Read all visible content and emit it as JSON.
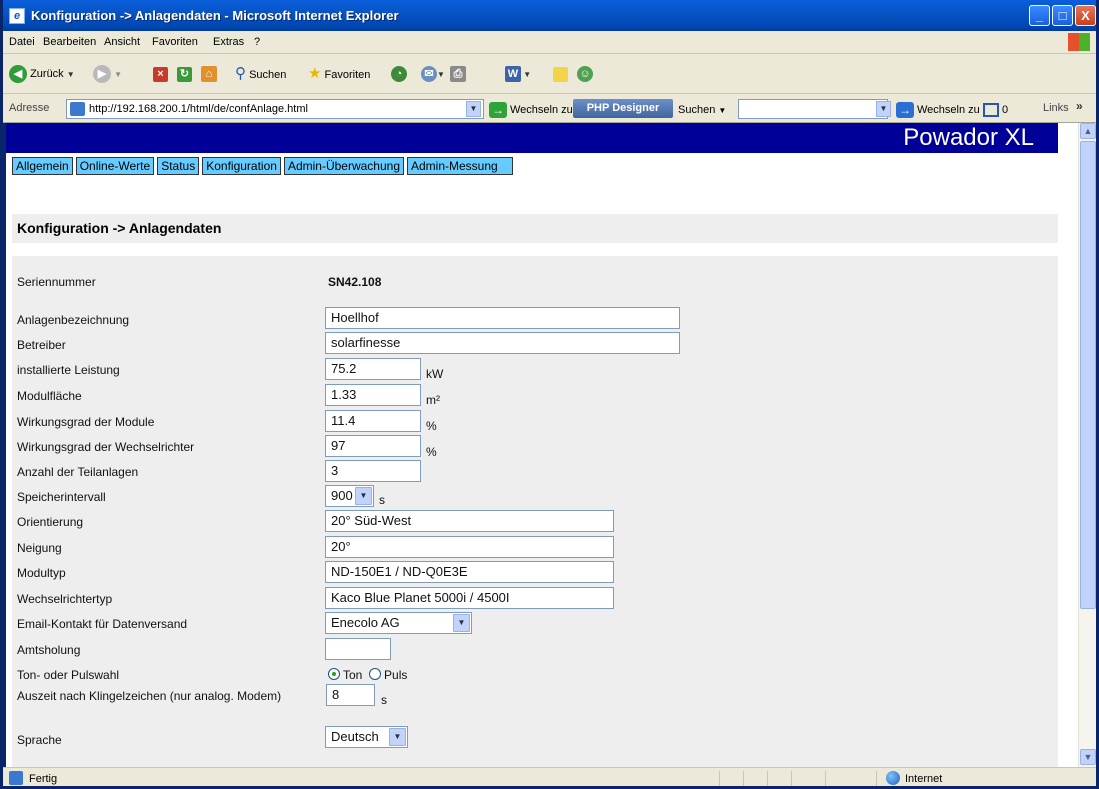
{
  "window": {
    "title": "Konfiguration -> Anlagendaten - Microsoft Internet Explorer",
    "buttons": {
      "minimize": "_",
      "maximize": "□",
      "close": "X"
    }
  },
  "menu": [
    "Datei",
    "Bearbeiten",
    "Ansicht",
    "Favoriten",
    "Extras",
    "?"
  ],
  "toolbar": {
    "back": "Zurück",
    "search": "Suchen",
    "favorites": "Favoriten"
  },
  "address": {
    "label": "Adresse",
    "url": "http://192.168.200.1/html/de/confAnlage.html",
    "go": "Wechseln zu",
    "php_designer": "PHP Designer",
    "search_label": "Suchen",
    "go2": "Wechseln zu",
    "counter": "0",
    "links": "Links"
  },
  "page": {
    "brand": "Powador XL",
    "nav": [
      "Allgemein",
      "Online-Werte",
      "Status",
      "Konfiguration",
      "Admin-Überwachung",
      "Admin-Messung"
    ],
    "section_title": "Konfiguration -> Anlagendaten",
    "serial_label": "Seriennummer",
    "serial_value": "SN42.108",
    "fields": {
      "anlagenbezeichnung": {
        "label": "Anlagenbezeichnung",
        "value": "Hoellhof"
      },
      "betreiber": {
        "label": "Betreiber",
        "value": "solarfinesse"
      },
      "leistung": {
        "label": "installierte Leistung",
        "value": "75.2",
        "unit": "kW"
      },
      "modulflaeche": {
        "label": "Modulfläche",
        "value": "1.33",
        "unit": "m²"
      },
      "wg_module": {
        "label": "Wirkungsgrad der Module",
        "value": "11.4",
        "unit": "%"
      },
      "wg_wr": {
        "label": "Wirkungsgrad der Wechselrichter",
        "value": "97",
        "unit": "%"
      },
      "teilanlagen": {
        "label": "Anzahl der Teilanlagen",
        "value": "3"
      },
      "speicherintervall": {
        "label": "Speicherintervall",
        "value": "900",
        "unit": "s"
      },
      "orientierung": {
        "label": "Orientierung",
        "value": "20° Süd-West"
      },
      "neigung": {
        "label": "Neigung",
        "value": "20°"
      },
      "modultyp": {
        "label": "Modultyp",
        "value": "ND-150E1 / ND-Q0E3E"
      },
      "wr_typ": {
        "label": "Wechselrichtertyp",
        "value": "Kaco Blue Planet 5000i / 4500I"
      },
      "email": {
        "label": "Email-Kontakt für Datenversand",
        "value": "Enecolo AG"
      },
      "amtsholung": {
        "label": "Amtsholung",
        "value": ""
      },
      "wahl": {
        "label": "Ton- oder Pulswahl",
        "option_ton": "Ton",
        "option_puls": "Puls",
        "selected": "Ton"
      },
      "auszeit": {
        "label": "Auszeit nach Klingelzeichen (nur analog. Modem)",
        "value": "8",
        "unit": "s"
      },
      "sprache": {
        "label": "Sprache",
        "value": "Deutsch"
      }
    }
  },
  "status": {
    "text": "Fertig",
    "zone": "Internet"
  }
}
